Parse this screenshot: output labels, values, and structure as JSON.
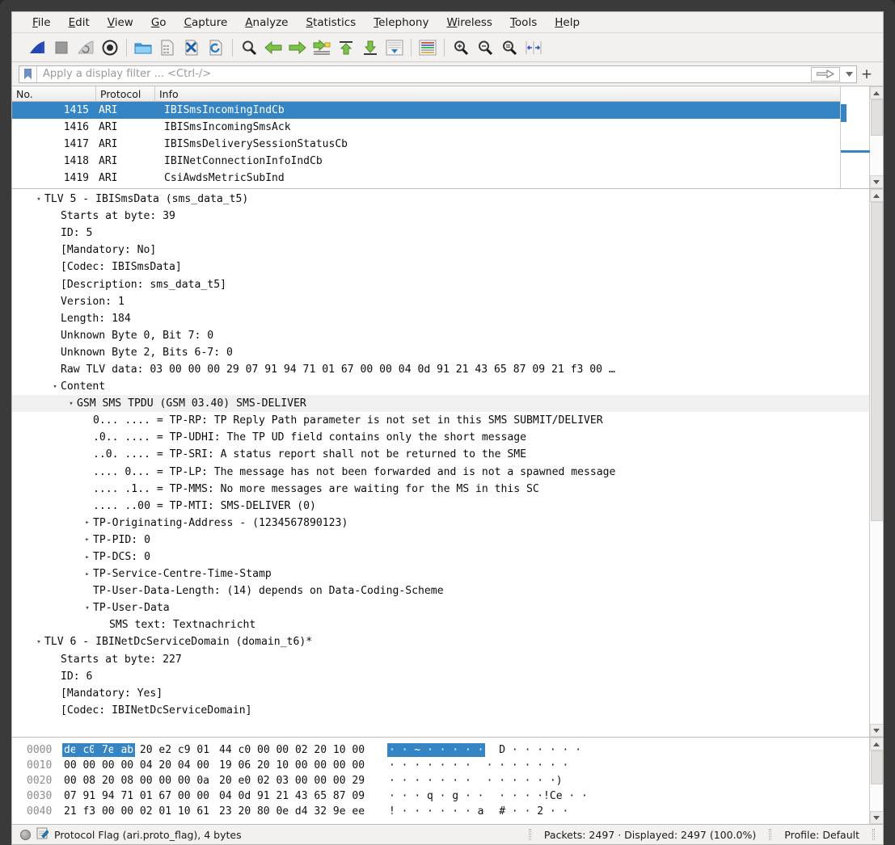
{
  "menu": {
    "items": [
      {
        "pre": "",
        "u": "F",
        "post": "ile"
      },
      {
        "pre": "",
        "u": "E",
        "post": "dit"
      },
      {
        "pre": "",
        "u": "V",
        "post": "iew"
      },
      {
        "pre": "",
        "u": "G",
        "post": "o"
      },
      {
        "pre": "",
        "u": "C",
        "post": "apture"
      },
      {
        "pre": "",
        "u": "A",
        "post": "nalyze"
      },
      {
        "pre": "",
        "u": "S",
        "post": "tatistics"
      },
      {
        "pre": "",
        "u": "T",
        "post": "elephony"
      },
      {
        "pre": "",
        "u": "W",
        "post": "ireless"
      },
      {
        "pre": "",
        "u": "T",
        "post": "ools"
      },
      {
        "pre": "",
        "u": "H",
        "post": "elp"
      }
    ]
  },
  "toolbar": {
    "icons": [
      "start-capture-icon",
      "stop-capture-icon",
      "restart-capture-icon",
      "capture-options-icon",
      "open-file-icon",
      "save-file-icon",
      "close-file-icon",
      "reload-file-icon",
      "find-packet-icon",
      "go-back-icon",
      "go-forward-icon",
      "go-to-packet-icon",
      "go-first-packet-icon",
      "go-last-packet-icon",
      "auto-scroll-icon",
      "colorize-icon",
      "zoom-in-icon",
      "zoom-out-icon",
      "zoom-reset-icon",
      "resize-columns-icon"
    ]
  },
  "filter": {
    "placeholder": "Apply a display filter ... <Ctrl-/>",
    "value": "",
    "plus_label": "+"
  },
  "packet_list": {
    "columns": [
      "No.",
      "Protocol",
      "Info"
    ],
    "rows": [
      {
        "no": "1415",
        "protocol": "ARI",
        "info": "IBISmsIncomingIndCb",
        "selected": true
      },
      {
        "no": "1416",
        "protocol": "ARI",
        "info": "IBISmsIncomingSmsAck",
        "selected": false
      },
      {
        "no": "1417",
        "protocol": "ARI",
        "info": "IBISmsDeliverySessionStatusCb",
        "selected": false
      },
      {
        "no": "1418",
        "protocol": "ARI",
        "info": "IBINetConnectionInfoIndCb",
        "selected": false
      },
      {
        "no": "1419",
        "protocol": "ARI",
        "info": "CsiAwdsMetricSubInd",
        "selected": false
      }
    ]
  },
  "detail_tree": {
    "rows": [
      {
        "indent": 1,
        "tri": "expanded",
        "text": "TLV 5 - IBISmsData (sms_data_t5)"
      },
      {
        "indent": 2,
        "tri": "none",
        "text": "Starts at byte: 39"
      },
      {
        "indent": 2,
        "tri": "none",
        "text": "ID: 5"
      },
      {
        "indent": 2,
        "tri": "none",
        "text": "[Mandatory: No]"
      },
      {
        "indent": 2,
        "tri": "none",
        "text": "[Codec: IBISmsData]"
      },
      {
        "indent": 2,
        "tri": "none",
        "text": "[Description: sms_data_t5]"
      },
      {
        "indent": 2,
        "tri": "none",
        "text": "Version: 1"
      },
      {
        "indent": 2,
        "tri": "none",
        "text": "Length: 184"
      },
      {
        "indent": 2,
        "tri": "none",
        "text": "Unknown Byte 0, Bit 7: 0"
      },
      {
        "indent": 2,
        "tri": "none",
        "text": "Unknown Byte 2, Bits 6-7: 0"
      },
      {
        "indent": 2,
        "tri": "none",
        "text": "Raw TLV data: 03 00 00 00 29 07 91 94 71 01 67 00 00 04 0d 91 21 43 65 87 09 21 f3 00 …"
      },
      {
        "indent": 2,
        "tri": "expanded",
        "text": "Content"
      },
      {
        "indent": 3,
        "tri": "expanded",
        "text": "GSM SMS TPDU (GSM 03.40) SMS-DELIVER",
        "highlight": true
      },
      {
        "indent": 4,
        "tri": "none",
        "text": "0... .... = TP-RP: TP Reply Path parameter is not set in this SMS SUBMIT/DELIVER"
      },
      {
        "indent": 4,
        "tri": "none",
        "text": ".0.. .... = TP-UDHI: The TP UD field contains only the short message"
      },
      {
        "indent": 4,
        "tri": "none",
        "text": "..0. .... = TP-SRI: A status report shall not be returned to the SME"
      },
      {
        "indent": 4,
        "tri": "none",
        "text": ".... 0... = TP-LP: The message has not been forwarded and is not a spawned message"
      },
      {
        "indent": 4,
        "tri": "none",
        "text": ".... .1.. = TP-MMS: No more messages are waiting for the MS in this SC"
      },
      {
        "indent": 4,
        "tri": "none",
        "text": ".... ..00 = TP-MTI: SMS-DELIVER (0)"
      },
      {
        "indent": 4,
        "tri": "collapsed",
        "text": "TP-Originating-Address - (1234567890123)"
      },
      {
        "indent": 4,
        "tri": "collapsed",
        "text": "TP-PID: 0"
      },
      {
        "indent": 4,
        "tri": "collapsed",
        "text": "TP-DCS: 0"
      },
      {
        "indent": 4,
        "tri": "collapsed",
        "text": "TP-Service-Centre-Time-Stamp"
      },
      {
        "indent": 4,
        "tri": "none",
        "text": "TP-User-Data-Length: (14) depends on Data-Coding-Scheme"
      },
      {
        "indent": 4,
        "tri": "expanded",
        "text": "TP-User-Data"
      },
      {
        "indent": 5,
        "tri": "none",
        "text": "SMS text: Textnachricht"
      },
      {
        "indent": 1,
        "tri": "expanded",
        "text": "TLV 6 - IBINetDcServiceDomain (domain_t6)*"
      },
      {
        "indent": 2,
        "tri": "none",
        "text": "Starts at byte: 227"
      },
      {
        "indent": 2,
        "tri": "none",
        "text": "ID: 6"
      },
      {
        "indent": 2,
        "tri": "none",
        "text": "[Mandatory: Yes]"
      },
      {
        "indent": 2,
        "tri": "none",
        "text": "[Codec: IBINetDcServiceDomain]"
      }
    ]
  },
  "hex_dump": {
    "rows": [
      {
        "offset": "0000",
        "g1": [
          "de",
          "c0",
          "7e",
          "ab",
          "20",
          "e2",
          "c9",
          "01"
        ],
        "g2": [
          "44",
          "c0",
          "00",
          "00",
          "02",
          "20",
          "10",
          "00"
        ],
        "sel_count": 4,
        "ascii1": "· · ~ ·  · · · ·",
        "ascii2": " D · · · ·   · ·"
      },
      {
        "offset": "0010",
        "g1": [
          "00",
          "00",
          "00",
          "00",
          "04",
          "20",
          "04",
          "00"
        ],
        "g2": [
          "19",
          "06",
          "20",
          "10",
          "00",
          "00",
          "00",
          "00"
        ],
        "sel_count": 0,
        "ascii1": "· · · · ·  · ·",
        "ascii2": " · ·  · · · · ·"
      },
      {
        "offset": "0020",
        "g1": [
          "00",
          "08",
          "20",
          "08",
          "00",
          "00",
          "00",
          "0a"
        ],
        "g2": [
          "20",
          "e0",
          "02",
          "03",
          "00",
          "00",
          "00",
          "29"
        ],
        "sel_count": 0,
        "ascii1": "· ·  · · · · ·",
        "ascii2": "  · · · · · ·)"
      },
      {
        "offset": "0030",
        "g1": [
          "07",
          "91",
          "94",
          "71",
          "01",
          "67",
          "00",
          "00"
        ],
        "g2": [
          "04",
          "0d",
          "91",
          "21",
          "43",
          "65",
          "87",
          "09"
        ],
        "sel_count": 0,
        "ascii1": "· · · q · g · ·",
        "ascii2": " · · · ·!Ce · ·"
      },
      {
        "offset": "0040",
        "g1": [
          "21",
          "f3",
          "00",
          "00",
          "02",
          "01",
          "10",
          "61"
        ],
        "g2": [
          "23",
          "20",
          "80",
          "0e",
          "d4",
          "32",
          "9e",
          "ee"
        ],
        "sel_count": 0,
        "ascii1": "! · · · · · · a",
        "ascii2": " # · · 2 · ·"
      }
    ]
  },
  "status_bar": {
    "field_info": "Protocol Flag (ari.proto_flag), 4 bytes",
    "packet_counts": "Packets: 2497 · Displayed: 2497 (100.0%)",
    "profile": "Profile: Default"
  },
  "colors": {
    "selection_blue": "#3584c4",
    "chrome_gray": "#f2f1f0",
    "frame_dark": "#3a3a3a",
    "highlight_row": "#f0f0f0"
  }
}
